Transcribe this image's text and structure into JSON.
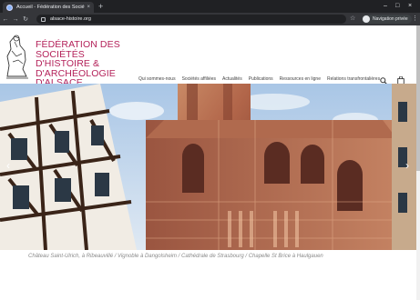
{
  "browser": {
    "tab_title": "Accueil - Fédération des Sociétés",
    "tab_close": "×",
    "new_tab": "+",
    "url": "alsace-histoire.org",
    "profile_label": "Navigation privée",
    "back": "←",
    "forward": "→",
    "reload": "↻",
    "star": "☆",
    "menu": "⋮",
    "minimize": "–",
    "maximize": "□",
    "close": "×"
  },
  "site": {
    "title": "Fédération des Sociétés d'Histoire & d'Archéologie d'Alsace",
    "nav": [
      {
        "label": "Qui sommes-nous"
      },
      {
        "label": "Sociétés affiliées"
      },
      {
        "label": "Actualités"
      },
      {
        "label": "Publications"
      },
      {
        "label": "Ressources en ligne"
      },
      {
        "label": "Relations transfrontalières"
      }
    ],
    "icons": {
      "search": "search-icon",
      "cart": "shopping-bag-icon"
    },
    "accent_color": "#b4225a"
  },
  "hero": {
    "prev": "‹",
    "next": "›",
    "caption": "Château Saint-Ulrich, à Ribeauvillé / Vignoble à Dangolsheim / Cathédrale de Strasbourg / Chapelle St Brice à Haulgauen"
  }
}
